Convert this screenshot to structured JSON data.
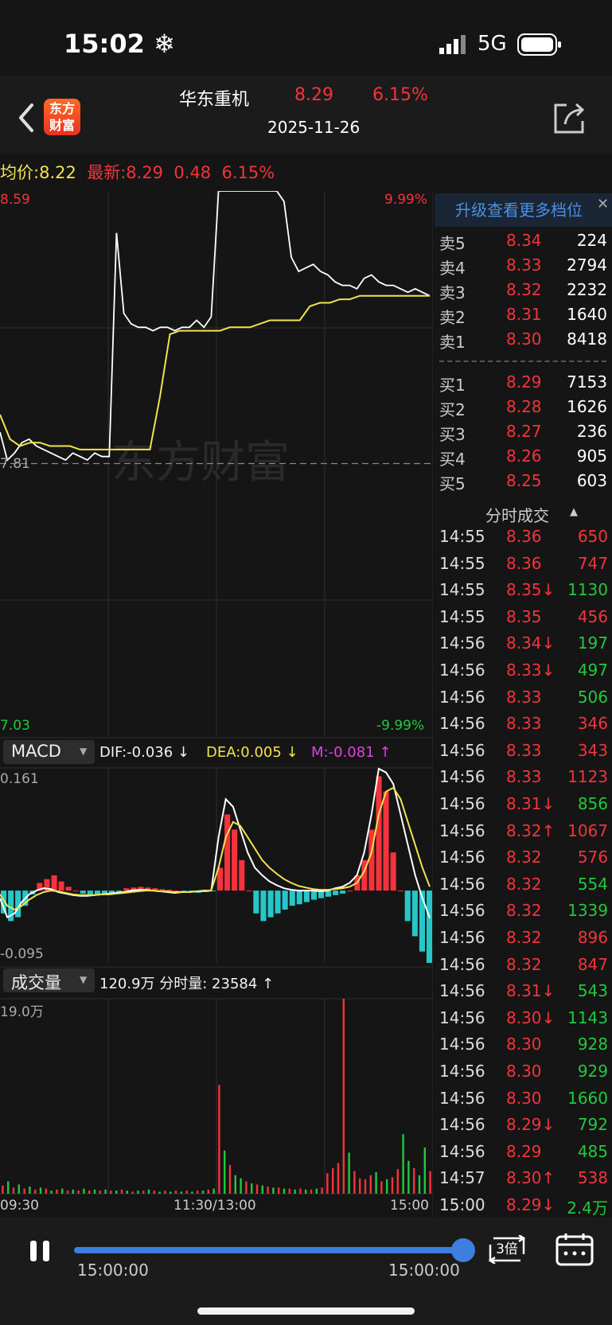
{
  "status_bar": {
    "time": "15:02",
    "snow_icon": "❄",
    "network": "5G"
  },
  "header": {
    "logo_line1": "东方",
    "logo_line2": "财富",
    "stock_name": "华东重机",
    "price": "8.29",
    "change_pct": "6.15%",
    "date": "2025-11-26"
  },
  "info_line": {
    "avg_label": "均价:",
    "avg_value": "8.22",
    "latest_label": "最新:",
    "latest_value": "8.29",
    "change": "0.48",
    "change_pct": "6.15%"
  },
  "price_chart": {
    "high_label": "8.59",
    "high_pct": "9.99%",
    "prev_close_label": "7.81",
    "low_label": "7.03",
    "low_pct": "-9.99%",
    "watermark": "东方财富",
    "prev_close": 7.81,
    "y_max": 8.59,
    "y_min": 7.03,
    "avg_series": [
      7.95,
      7.88,
      7.86,
      7.87,
      7.87,
      7.86,
      7.86,
      7.86,
      7.85,
      7.85,
      7.85,
      7.85,
      7.85,
      7.85,
      7.85,
      7.85,
      8.0,
      8.18,
      8.19,
      8.19,
      8.19,
      8.19,
      8.19,
      8.2,
      8.2,
      8.2,
      8.21,
      8.22,
      8.22,
      8.22,
      8.22,
      8.26,
      8.27,
      8.27,
      8.28,
      8.28,
      8.29,
      8.29,
      8.29,
      8.29,
      8.29,
      8.29,
      8.29,
      8.29
    ],
    "price_series": [
      7.9,
      7.82,
      7.84,
      7.87,
      7.88,
      7.86,
      7.85,
      7.84,
      7.83,
      7.82,
      7.84,
      7.83,
      7.82,
      7.84,
      7.83,
      7.83,
      8.47,
      8.24,
      8.21,
      8.2,
      8.2,
      8.19,
      8.2,
      8.2,
      8.19,
      8.2,
      8.2,
      8.22,
      8.2,
      8.23,
      8.59,
      8.59,
      8.59,
      8.59,
      8.59,
      8.59,
      8.59,
      8.59,
      8.59,
      8.56,
      8.4,
      8.36,
      8.37,
      8.38,
      8.36,
      8.35,
      8.33,
      8.32,
      8.32,
      8.31,
      8.34,
      8.35,
      8.33,
      8.32,
      8.32,
      8.31,
      8.3,
      8.31,
      8.3,
      8.29
    ]
  },
  "macd": {
    "selector": "MACD",
    "dif": "DIF:-0.036 ↓",
    "dea": "DEA:0.005 ↓",
    "m": "M:-0.081 ↑",
    "top_label": "0.161",
    "bottom_label": "-0.095",
    "y_max": 0.161,
    "y_min": -0.095,
    "hist": [
      -0.03,
      -0.04,
      -0.035,
      -0.02,
      -0.005,
      0.01,
      0.015,
      0.02,
      0.012,
      0.005,
      0.0,
      -0.004,
      -0.005,
      -0.006,
      -0.005,
      -0.004,
      -0.003,
      0.003,
      0.004,
      0.005,
      0.004,
      0.003,
      0.002,
      0.001,
      0.0,
      -0.002,
      -0.002,
      -0.003,
      -0.002,
      -0.001,
      0.03,
      0.1,
      0.08,
      0.04,
      0.0,
      -0.03,
      -0.04,
      -0.035,
      -0.03,
      -0.025,
      -0.02,
      -0.018,
      -0.015,
      -0.012,
      -0.01,
      -0.008,
      -0.006,
      -0.004,
      0.0,
      0.02,
      0.04,
      0.08,
      0.15,
      0.13,
      0.05,
      0.0,
      -0.04,
      -0.06,
      -0.08,
      -0.095
    ],
    "dif_series": [
      -0.01,
      -0.035,
      -0.03,
      -0.015,
      -0.005,
      0.0,
      0.003,
      0.002,
      -0.002,
      -0.004,
      -0.006,
      -0.007,
      -0.007,
      -0.006,
      -0.005,
      -0.004,
      -0.003,
      -0.002,
      0.0,
      0.001,
      0.001,
      0.0,
      -0.001,
      -0.002,
      -0.003,
      -0.002,
      -0.002,
      -0.001,
      0.0,
      0.0,
      0.07,
      0.12,
      0.11,
      0.08,
      0.05,
      0.03,
      0.02,
      0.012,
      0.007,
      0.003,
      0.001,
      0.0,
      0.0,
      0.0,
      -0.001,
      0.0,
      0.003,
      0.005,
      0.01,
      0.02,
      0.05,
      0.1,
      0.16,
      0.155,
      0.14,
      0.1,
      0.06,
      0.02,
      -0.01,
      -0.036
    ],
    "dea_series": [
      -0.005,
      -0.02,
      -0.025,
      -0.02,
      -0.012,
      -0.006,
      -0.002,
      0.0,
      -0.001,
      -0.003,
      -0.005,
      -0.006,
      -0.006,
      -0.006,
      -0.005,
      -0.005,
      -0.004,
      -0.003,
      -0.002,
      -0.001,
      0.0,
      0.0,
      -0.001,
      -0.001,
      -0.002,
      -0.002,
      -0.002,
      -0.001,
      -0.001,
      0.0,
      0.03,
      0.07,
      0.09,
      0.085,
      0.07,
      0.055,
      0.04,
      0.03,
      0.022,
      0.015,
      0.01,
      0.006,
      0.004,
      0.002,
      0.001,
      0.001,
      0.002,
      0.003,
      0.005,
      0.01,
      0.025,
      0.05,
      0.1,
      0.13,
      0.135,
      0.12,
      0.09,
      0.06,
      0.03,
      0.005
    ]
  },
  "volume": {
    "selector": "成交量",
    "summary": "120.9万 分时量: 23584 ↑",
    "top_label": "19.0万",
    "x_start": "09:30",
    "x_mid": "11:30/13:00",
    "x_end": "15:00",
    "y_max": 19.0,
    "bars": [
      0.8,
      1.2,
      0.6,
      0.9,
      0.5,
      0.7,
      0.4,
      0.6,
      0.5,
      0.3,
      0.4,
      0.5,
      0.3,
      0.4,
      0.3,
      0.5,
      0.3,
      0.4,
      0.3,
      0.4,
      0.3,
      0.3,
      0.4,
      0.3,
      0.2,
      0.3,
      0.3,
      0.4,
      0.3,
      0.2,
      0.3,
      0.2,
      0.3,
      0.2,
      0.3,
      0.2,
      0.3,
      0.3,
      0.4,
      0.5,
      10.6,
      4.2,
      2.8,
      1.8,
      1.5,
      1.2,
      1.0,
      0.9,
      0.8,
      0.7,
      0.6,
      0.6,
      0.5,
      0.5,
      0.4,
      0.5,
      0.4,
      0.4,
      0.5,
      0.6,
      2.0,
      2.5,
      3.0,
      19.0,
      4.0,
      2.2,
      1.5,
      1.4,
      1.8,
      2.1,
      1.2,
      1.4,
      1.6,
      2.4,
      5.8,
      3.2,
      2.5,
      1.8,
      4.5,
      2.2
    ],
    "bar_colors": [
      "r",
      "g",
      "r",
      "g",
      "r",
      "g",
      "r",
      "g",
      "r",
      "g",
      "r",
      "g",
      "r",
      "g",
      "r",
      "g",
      "r",
      "g",
      "r",
      "g",
      "r",
      "g",
      "r",
      "g",
      "r",
      "g",
      "r",
      "g",
      "r",
      "g",
      "r",
      "g",
      "r",
      "g",
      "r",
      "g",
      "r",
      "g",
      "r",
      "g",
      "r",
      "g",
      "r",
      "g",
      "g",
      "r",
      "g",
      "r",
      "g",
      "r",
      "g",
      "r",
      "g",
      "r",
      "g",
      "r",
      "g",
      "r",
      "g",
      "r",
      "r",
      "r",
      "r",
      "r",
      "g",
      "r",
      "r",
      "r",
      "r",
      "g",
      "r",
      "g",
      "r",
      "r",
      "g",
      "g",
      "r",
      "g",
      "g",
      "r"
    ]
  },
  "order_book": {
    "banner": "升级查看更多档位",
    "asks": [
      {
        "label": "卖5",
        "price": "8.34",
        "vol": "224"
      },
      {
        "label": "卖4",
        "price": "8.33",
        "vol": "2794"
      },
      {
        "label": "卖3",
        "price": "8.32",
        "vol": "2232"
      },
      {
        "label": "卖2",
        "price": "8.31",
        "vol": "1640"
      },
      {
        "label": "卖1",
        "price": "8.30",
        "vol": "8418"
      }
    ],
    "bids": [
      {
        "label": "买1",
        "price": "8.29",
        "vol": "7153"
      },
      {
        "label": "买2",
        "price": "8.28",
        "vol": "1626"
      },
      {
        "label": "买3",
        "price": "8.27",
        "vol": "236"
      },
      {
        "label": "买4",
        "price": "8.26",
        "vol": "905"
      },
      {
        "label": "买5",
        "price": "8.25",
        "vol": "603"
      }
    ]
  },
  "ticks": {
    "title": "分时成交",
    "rows": [
      {
        "time": "14:55",
        "price": "8.36",
        "vol": "650",
        "c": "red"
      },
      {
        "time": "14:55",
        "price": "8.36",
        "vol": "747",
        "c": "red"
      },
      {
        "time": "14:55",
        "price": "8.35↓",
        "vol": "1130",
        "c": "green"
      },
      {
        "time": "14:55",
        "price": "8.35",
        "vol": "456",
        "c": "red"
      },
      {
        "time": "14:56",
        "price": "8.34↓",
        "vol": "197",
        "c": "green"
      },
      {
        "time": "14:56",
        "price": "8.33↓",
        "vol": "497",
        "c": "green"
      },
      {
        "time": "14:56",
        "price": "8.33",
        "vol": "506",
        "c": "green"
      },
      {
        "time": "14:56",
        "price": "8.33",
        "vol": "346",
        "c": "red"
      },
      {
        "time": "14:56",
        "price": "8.33",
        "vol": "343",
        "c": "red"
      },
      {
        "time": "14:56",
        "price": "8.33",
        "vol": "1123",
        "c": "red"
      },
      {
        "time": "14:56",
        "price": "8.31↓",
        "vol": "856",
        "c": "green"
      },
      {
        "time": "14:56",
        "price": "8.32↑",
        "vol": "1067",
        "c": "red"
      },
      {
        "time": "14:56",
        "price": "8.32",
        "vol": "576",
        "c": "red"
      },
      {
        "time": "14:56",
        "price": "8.32",
        "vol": "554",
        "c": "green"
      },
      {
        "time": "14:56",
        "price": "8.32",
        "vol": "1339",
        "c": "green"
      },
      {
        "time": "14:56",
        "price": "8.32",
        "vol": "896",
        "c": "red"
      },
      {
        "time": "14:56",
        "price": "8.32",
        "vol": "847",
        "c": "red"
      },
      {
        "time": "14:56",
        "price": "8.31↓",
        "vol": "543",
        "c": "green"
      },
      {
        "time": "14:56",
        "price": "8.30↓",
        "vol": "1143",
        "c": "green"
      },
      {
        "time": "14:56",
        "price": "8.30",
        "vol": "928",
        "c": "green"
      },
      {
        "time": "14:56",
        "price": "8.30",
        "vol": "929",
        "c": "green"
      },
      {
        "time": "14:56",
        "price": "8.30",
        "vol": "1660",
        "c": "green"
      },
      {
        "time": "14:56",
        "price": "8.29↓",
        "vol": "792",
        "c": "green"
      },
      {
        "time": "14:56",
        "price": "8.29",
        "vol": "485",
        "c": "green"
      },
      {
        "time": "14:57",
        "price": "8.30↑",
        "vol": "538",
        "c": "red"
      },
      {
        "time": "15:00",
        "price": "8.29↓",
        "vol": "2.4万",
        "c": "green"
      }
    ]
  },
  "playback": {
    "start_time": "15:00:00",
    "end_time": "15:00:00",
    "speed": "3倍",
    "progress": 1.0
  },
  "colors": {
    "up": "#f4333c",
    "down": "#22c93c",
    "avg": "#f2e34d",
    "price": "#ffffff",
    "macd_neg": "#27c6c8"
  }
}
